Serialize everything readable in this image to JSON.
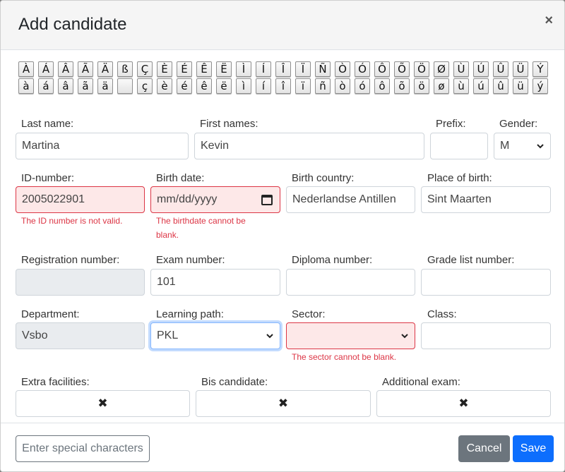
{
  "header": {
    "title": "Add candidate",
    "close_symbol": "×"
  },
  "special_chars": {
    "row1": [
      "À",
      "Á",
      "Â",
      "Ã",
      "Ä",
      "ß",
      "Ç",
      "È",
      "É",
      "Ê",
      "Ë",
      "Ì",
      "Í",
      "Î",
      "Ï",
      "Ñ",
      "Ò",
      "Ó",
      "Ô",
      "Õ",
      "Ö",
      "Ø",
      "Ù",
      "Ú",
      "Û",
      "Ü",
      "Ý"
    ],
    "row2": [
      "à",
      "á",
      "â",
      "ã",
      "ä",
      "",
      "ç",
      "è",
      "é",
      "ê",
      "ë",
      "ì",
      "í",
      "î",
      "ï",
      "ñ",
      "ò",
      "ó",
      "ô",
      "õ",
      "ö",
      "ø",
      "ù",
      "ú",
      "û",
      "ü",
      "ý"
    ]
  },
  "form": {
    "last_name": {
      "label": "Last name:",
      "value": "Martina"
    },
    "first_names": {
      "label": "First names:",
      "value": "Kevin"
    },
    "prefix": {
      "label": "Prefix:",
      "value": ""
    },
    "gender": {
      "label": "Gender:",
      "value": "M"
    },
    "id_number": {
      "label": "ID-number:",
      "value": "2005022901",
      "error": "The ID number is not valid."
    },
    "birth_date": {
      "label": "Birth date:",
      "placeholder": "mm/dd/yyyy",
      "error_line1": "The birthdate cannot be",
      "error_line2": "blank."
    },
    "birth_country": {
      "label": "Birth country:",
      "value": "Nederlandse Antillen"
    },
    "place_of_birth": {
      "label": "Place of birth:",
      "value": "Sint Maarten"
    },
    "registration_number": {
      "label": "Registration number:",
      "value": ""
    },
    "exam_number": {
      "label": "Exam number:",
      "value": "101"
    },
    "diploma_number": {
      "label": "Diploma number:",
      "value": ""
    },
    "grade_list_number": {
      "label": "Grade list number:",
      "value": ""
    },
    "department": {
      "label": "Department:",
      "value": "Vsbo"
    },
    "learning_path": {
      "label": "Learning path:",
      "value": "PKL"
    },
    "sector": {
      "label": "Sector:",
      "value": "",
      "error": "The sector cannot be blank."
    },
    "class": {
      "label": "Class:",
      "value": ""
    },
    "extra_facilities": {
      "label": "Extra facilities:",
      "mark": "✖"
    },
    "bis_candidate": {
      "label": "Bis candidate:",
      "mark": "✖"
    },
    "additional_exam": {
      "label": "Additional exam:",
      "mark": "✖"
    }
  },
  "footer": {
    "special_chars_button": "Enter special characters",
    "cancel_button": "Cancel",
    "save_button": "Save"
  },
  "colors": {
    "primary": "#0d6efd",
    "secondary": "#6c757d",
    "danger": "#dc3545",
    "invalid_bg": "#fde8e8"
  }
}
